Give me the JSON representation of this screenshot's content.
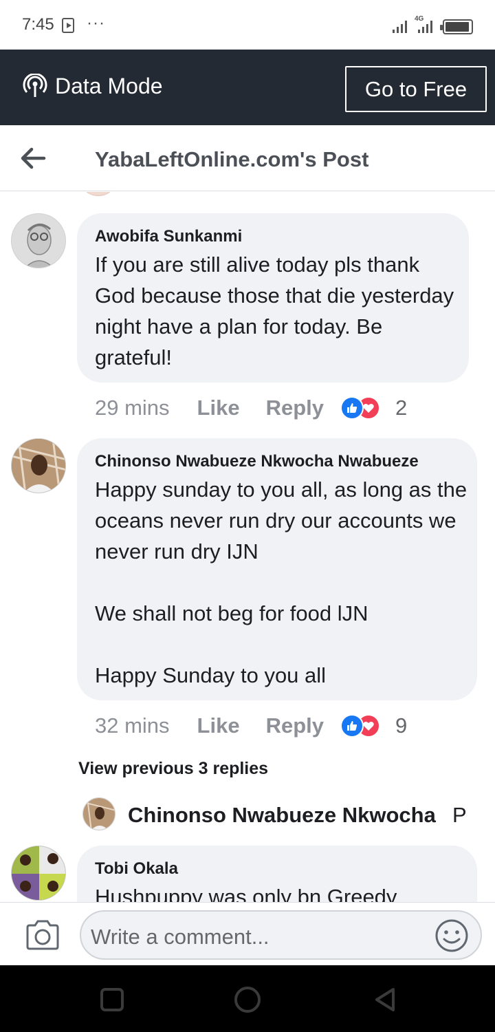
{
  "status_bar": {
    "time": "7:45",
    "dots": "···",
    "network": "4G",
    "battery_level": 0.95
  },
  "data_mode": {
    "label": "Data Mode",
    "go_free_label": "Go to Free"
  },
  "header": {
    "title": "YabaLeftOnline.com's Post"
  },
  "comments": [
    {
      "author": "Awobifa Sunkanmi",
      "text": "If you are still alive today pls thank God because those that die yesterday night have a plan for today. Be grateful!",
      "time": "29 mins",
      "like_label": "Like",
      "reply_label": "Reply",
      "reaction_count": "2"
    },
    {
      "author": "Chinonso Nwabueze Nkwocha Nwabueze",
      "text": "Happy sunday to you all, as long as the oceans never run dry our accounts we never run dry IJN\n\nWe shall not beg for food lJN\n\nHappy Sunday to you all",
      "time": "32 mins",
      "like_label": "Like",
      "reply_label": "Reply",
      "reaction_count": "9"
    },
    {
      "author": "Tobi Okala",
      "text": "Hushpuppy was only bn  Greedy"
    }
  ],
  "replies": {
    "view_previous_label": "View previous 3 replies",
    "preview_author": "Chinonso Nwabueze Nkwocha",
    "preview_snippet": "P"
  },
  "composer": {
    "placeholder": "Write a comment..."
  }
}
